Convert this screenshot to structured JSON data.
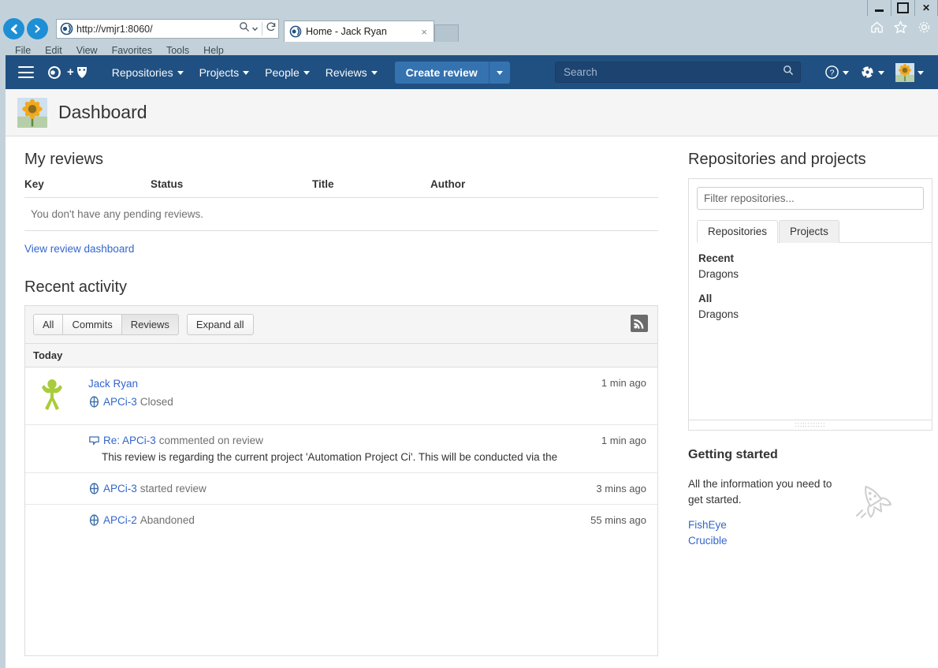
{
  "window": {
    "minimize_label": "Minimize",
    "maximize_label": "Maximize",
    "close_label": "✕"
  },
  "browser": {
    "url": "http://vmjr1:8060/",
    "tab_title": "Home - Jack Ryan",
    "tab_close": "×",
    "menu": [
      "File",
      "Edit",
      "View",
      "Favorites",
      "Tools",
      "Help"
    ],
    "back_icon": "back-arrow-icon",
    "forward_icon": "forward-arrow-icon",
    "search_icon": "magnifier-icon",
    "refresh_icon": "refresh-icon",
    "home_icon": "home-icon",
    "favorites_icon": "star-icon",
    "tools_icon": "gear-icon"
  },
  "appnav": {
    "menu_icon": "hamburger-icon",
    "logo_icon": "fisheye-crucible-logo",
    "items": [
      {
        "label": "Repositories",
        "has_caret": true
      },
      {
        "label": "Projects",
        "has_caret": true
      },
      {
        "label": "People",
        "has_caret": true
      },
      {
        "label": "Reviews",
        "has_caret": true
      }
    ],
    "create_button": "Create review",
    "create_caret_icon": "chevron-down-icon",
    "search_placeholder": "Search",
    "search_value": "",
    "help_icon": "question-circle-icon",
    "settings_icon": "gear-icon",
    "avatar_icon": "sunflower-avatar",
    "brand_color": "#205081",
    "accent_color": "#3572b0"
  },
  "page_header": {
    "title": "Dashboard",
    "avatar_icon": "sunflower-avatar"
  },
  "my_reviews": {
    "heading": "My reviews",
    "columns": [
      "Key",
      "Status",
      "Title",
      "Author"
    ],
    "empty_message": "You don't have any pending reviews.",
    "footer_link": "View review dashboard"
  },
  "recent_activity": {
    "heading": "Recent activity",
    "filters": [
      {
        "label": "All",
        "active": false
      },
      {
        "label": "Commits",
        "active": false
      },
      {
        "label": "Reviews",
        "active": true
      }
    ],
    "expand_all": "Expand all",
    "rss_icon": "rss-feed-icon",
    "day_header": "Today",
    "items": [
      {
        "user": "Jack Ryan",
        "avatar_icon": "green-person-avatar",
        "icon": "review-icon",
        "key": "APCi-3",
        "action": "Closed",
        "time": "1 min ago",
        "description": ""
      },
      {
        "user": "",
        "avatar_icon": "",
        "icon": "comment-icon",
        "key": "Re: APCi-3",
        "action": "commented on review",
        "time": "1 min ago",
        "description": "This review is regarding the current project 'Automation Project Ci'. This will be conducted via the"
      },
      {
        "user": "",
        "avatar_icon": "",
        "icon": "review-icon",
        "key": "APCi-3",
        "action": "started review",
        "time": "3 mins ago",
        "description": ""
      },
      {
        "user": "",
        "avatar_icon": "",
        "icon": "review-icon",
        "key": "APCi-2",
        "action": "Abandoned",
        "time": "55 mins ago",
        "description": ""
      }
    ]
  },
  "repositories_panel": {
    "heading": "Repositories and projects",
    "filter_placeholder": "Filter repositories...",
    "filter_value": "",
    "tabs": [
      {
        "label": "Repositories",
        "active": true
      },
      {
        "label": "Projects",
        "active": false
      }
    ],
    "groups": [
      {
        "title": "Recent",
        "items": [
          "Dragons"
        ]
      },
      {
        "title": "All",
        "items": [
          "Dragons"
        ]
      }
    ],
    "resize_grip_icon": "resize-grip-icon"
  },
  "getting_started": {
    "heading": "Getting started",
    "text": "All the information you need to get started.",
    "rocket_icon": "rocket-icon",
    "links": [
      "FishEye",
      "Crucible"
    ]
  }
}
